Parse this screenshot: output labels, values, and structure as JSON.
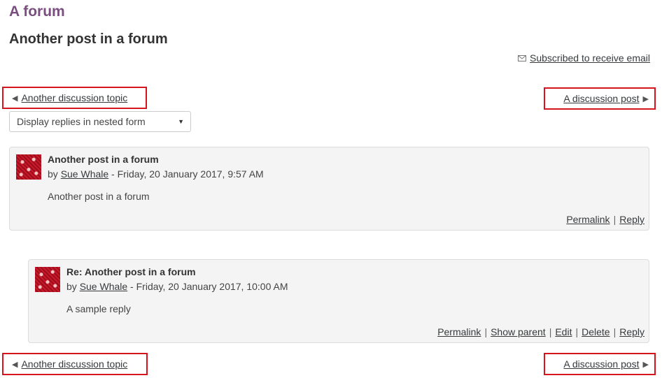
{
  "forum_title": "A forum",
  "discussion_title": "Another post in a forum",
  "subscription": {
    "icon": "envelope-icon",
    "label": "Subscribed to receive email"
  },
  "navigation": {
    "prev_label": "Another discussion topic",
    "next_label": "A discussion post",
    "prev_arrow": "◀",
    "next_arrow": "▶"
  },
  "display_mode": {
    "selected": "Display replies in nested form"
  },
  "posts": [
    {
      "subject": "Another post in a forum",
      "author_prefix": "by ",
      "author": "Sue Whale",
      "date": " - Friday, 20 January 2017, 9:57 AM",
      "body": "Another post in a forum",
      "commands": [
        "Permalink",
        "Reply"
      ]
    },
    {
      "subject": "Re: Another post in a forum",
      "author_prefix": "by ",
      "author": "Sue Whale",
      "date": " - Friday, 20 January 2017, 10:00 AM",
      "body": "A sample reply",
      "commands": [
        "Permalink",
        "Show parent",
        "Edit",
        "Delete",
        "Reply"
      ]
    }
  ],
  "colors": {
    "forum_title": "#7a4f80",
    "highlight_border": "#d7141e",
    "post_background": "#f4f4f4"
  }
}
